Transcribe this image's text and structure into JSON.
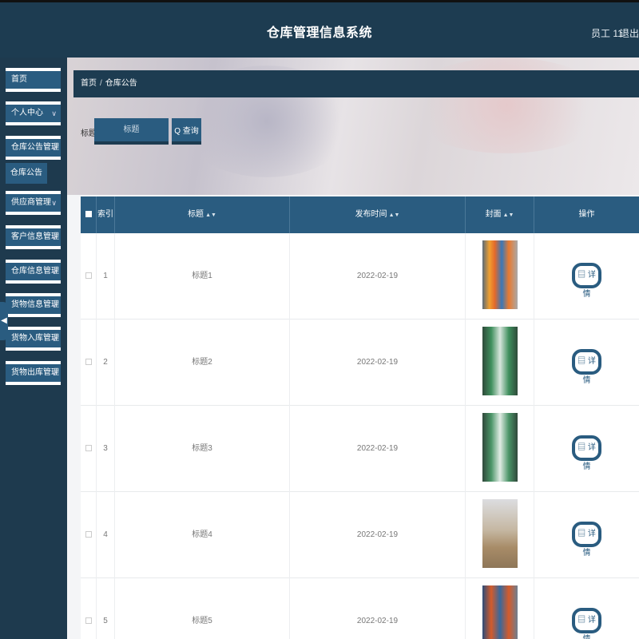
{
  "header": {
    "title": "仓库管理信息系统",
    "user": "员工 11",
    "logout": "退出登录"
  },
  "sidebar": {
    "items": [
      {
        "label": "首页",
        "has_chevron": false
      },
      {
        "label": "个人中心",
        "has_chevron": true
      },
      {
        "label": "仓库公告管理",
        "has_chevron": true
      },
      {
        "label": "供应商管理",
        "has_chevron": true
      },
      {
        "label": "客户信息管理",
        "has_chevron": true
      },
      {
        "label": "仓库信息管理",
        "has_chevron": true
      },
      {
        "label": "货物信息管理",
        "has_chevron": true
      },
      {
        "label": "货物入库管理",
        "has_chevron": true
      },
      {
        "label": "货物出库管理",
        "has_chevron": true
      }
    ],
    "sub_item": "仓库公告",
    "chevron": "∨",
    "collapse_icon": "◀"
  },
  "breadcrumb": {
    "home": "首页",
    "separator": "/",
    "current": "仓库公告"
  },
  "search": {
    "label": "标题",
    "placeholder": "标题",
    "button": "Q 查询"
  },
  "table": {
    "headers": {
      "index": "索引",
      "title": "标题",
      "date": "发布时间",
      "cover": "封面",
      "op": "操作"
    },
    "sort_icon": "▲▼",
    "detail_label": "▤ 详情",
    "rows": [
      {
        "index": "1",
        "title": "标题1",
        "date": "2022-02-19"
      },
      {
        "index": "2",
        "title": "标题2",
        "date": "2022-02-19"
      },
      {
        "index": "3",
        "title": "标题3",
        "date": "2022-02-19"
      },
      {
        "index": "4",
        "title": "标题4",
        "date": "2022-02-19"
      },
      {
        "index": "5",
        "title": "标题5",
        "date": "2022-02-19"
      }
    ]
  },
  "colors": {
    "header_bg": "#1d3c51",
    "accent": "#2a5c80",
    "sidebar_bg": "#1e3a4e"
  }
}
